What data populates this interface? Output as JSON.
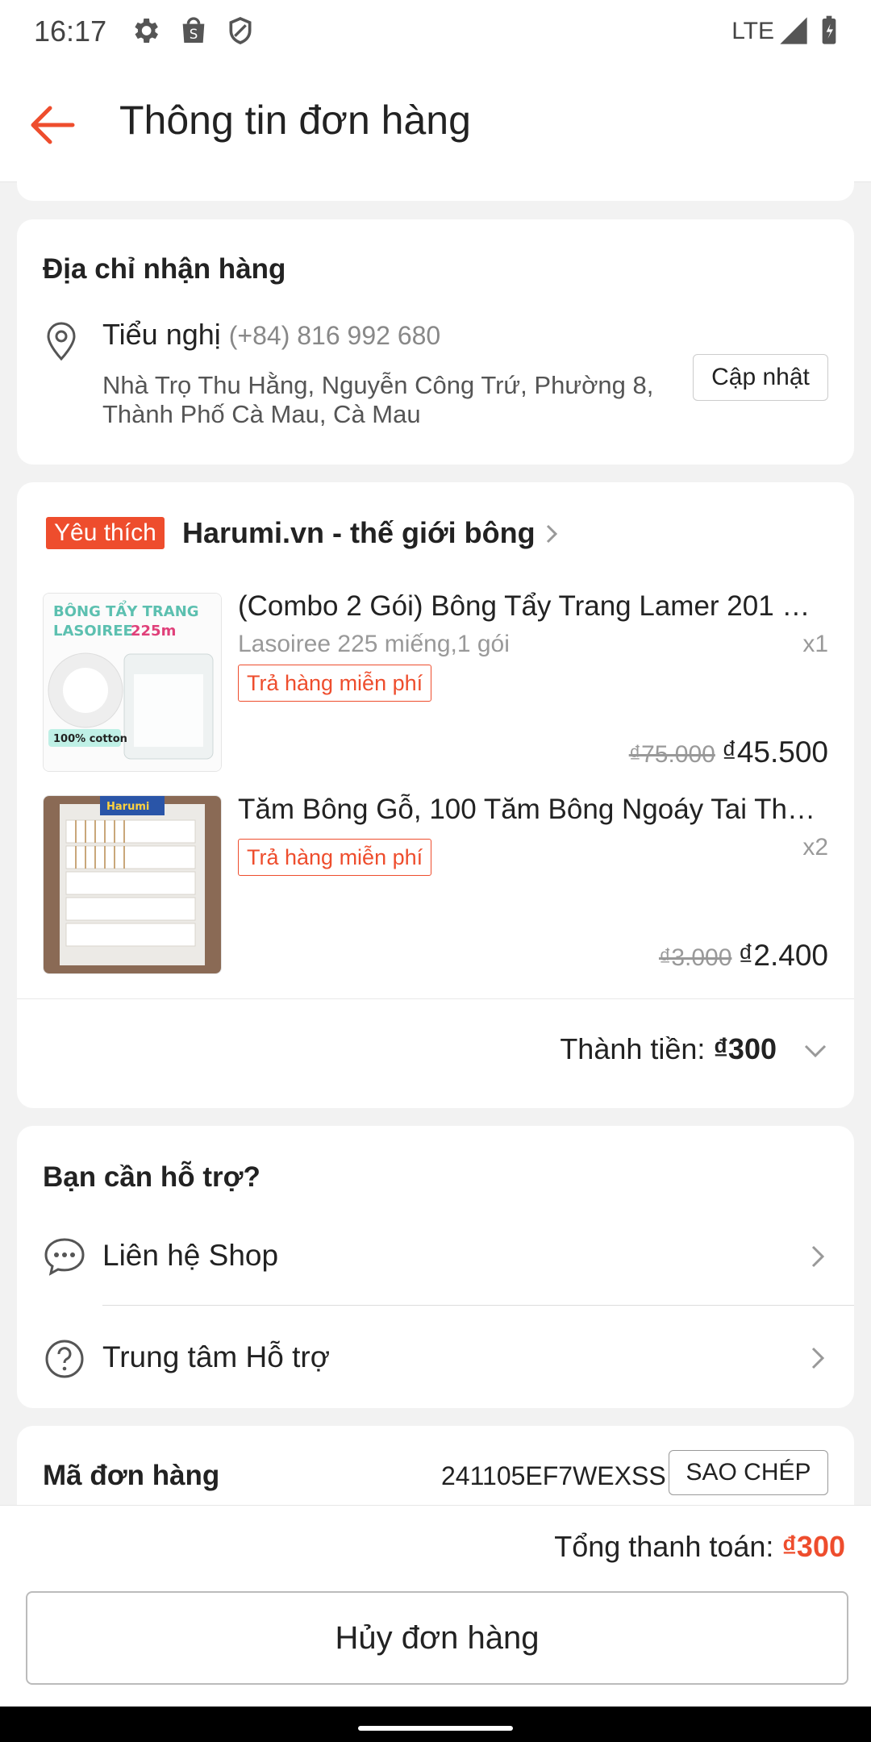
{
  "status_bar": {
    "time": "16:17",
    "network": "LTE",
    "icons": [
      "gear-icon",
      "shop-bag-icon",
      "shield-icon",
      "signal-icon",
      "battery-icon"
    ]
  },
  "app_bar": {
    "title": "Thông tin đơn hàng"
  },
  "address": {
    "heading": "Địa chỉ nhận hàng",
    "name": "Tiểu nghị",
    "phone": "(+84) 816 992 680",
    "line1": "Nhà Trọ Thu Hằng, Nguyễn Công Trứ, Phường 8,",
    "line2": "Thành Phố Cà Mau, Cà Mau",
    "update_label": "Cập nhật"
  },
  "shop": {
    "badge": "Yêu thích",
    "name": "Harumi.vn - thế giới bông",
    "products": [
      {
        "name": "(Combo 2 Gói) Bông Tẩy Trang Lamer 201 …",
        "variant": "Lasoiree 225 miếng,1 gói",
        "qty": "x1",
        "tag": "Trả hàng miễn phí",
        "old_price": "₫75.000",
        "price": "₫45.500",
        "thumb_text1": "BÔNG TẨY TRANG",
        "thumb_text2": "LASOIREE",
        "thumb_text3": "225m",
        "thumb_text4": "100% cotton"
      },
      {
        "name": "Tăm Bông Gỗ, 100 Tăm Bông Ngoáy Tai Th…",
        "variant": "",
        "qty": "x2",
        "tag": "Trả hàng miễn phí",
        "old_price": "₫3.000",
        "price": "₫2.400",
        "thumb_text1": "Harumi"
      }
    ],
    "total_label": "Thành tiền:",
    "total_value": "₫300"
  },
  "support": {
    "heading": "Bạn cần hỗ trợ?",
    "items": [
      {
        "label": "Liên hệ Shop"
      },
      {
        "label": "Trung tâm Hỗ trợ"
      }
    ]
  },
  "order": {
    "label": "Mã đơn hàng",
    "code": "241105EF7WEXSS",
    "copy_label": "SAO CHÉP"
  },
  "footer": {
    "total_label": "Tổng thanh toán:",
    "total_value": "₫300",
    "cancel_label": "Hủy đơn hàng"
  },
  "colors": {
    "accent": "#ee4d2d",
    "background": "#f2f2f2"
  }
}
